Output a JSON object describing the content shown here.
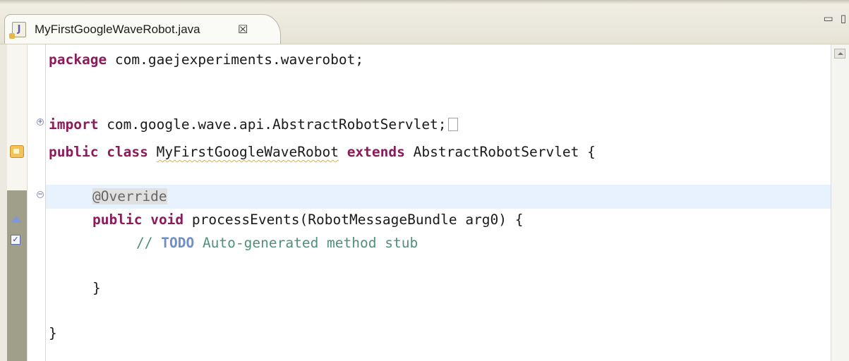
{
  "tab": {
    "title": "MyFirstGoogleWaveRobot.java",
    "file_icon": "java-file-icon",
    "close_icon": "close-icon",
    "close_glyph": "☒"
  },
  "view_controls": {
    "minimize_icon": "minimize-icon",
    "maximize_icon": "maximize-icon"
  },
  "colors": {
    "keyword": "#8b1b5a",
    "comment": "#4f8f7c",
    "todo": "#6f8fc5",
    "annotation": "#666666",
    "current_line_highlight": "#e8f2fe"
  },
  "code": {
    "line1": {
      "kw": "package",
      "rest": " com.gaejexperiments.waverobot;"
    },
    "line2": {
      "kw": "import",
      "rest": " com.google.wave.api.AbstractRobotServlet;"
    },
    "line3": {
      "kw1": "public",
      "kw2": "class",
      "name": "MyFirstGoogleWaveRobot",
      "kw3": "extends",
      "rest": " AbstractRobotServlet {"
    },
    "line4": {
      "annotation": "@Override"
    },
    "line5": {
      "kw1": "public",
      "kw2": "void",
      "rest": " processEvents(RobotMessageBundle arg0) {"
    },
    "line6": {
      "slashes": "// ",
      "todo": "TODO",
      "rest": " Auto-generated method stub"
    },
    "line7": {
      "text": "}"
    },
    "line8": {
      "text": "}"
    }
  },
  "ruler_markers": [
    "warning-icon",
    "override-icon",
    "task-icon"
  ],
  "fold_icons": {
    "expand": "+",
    "collapse": "−"
  }
}
